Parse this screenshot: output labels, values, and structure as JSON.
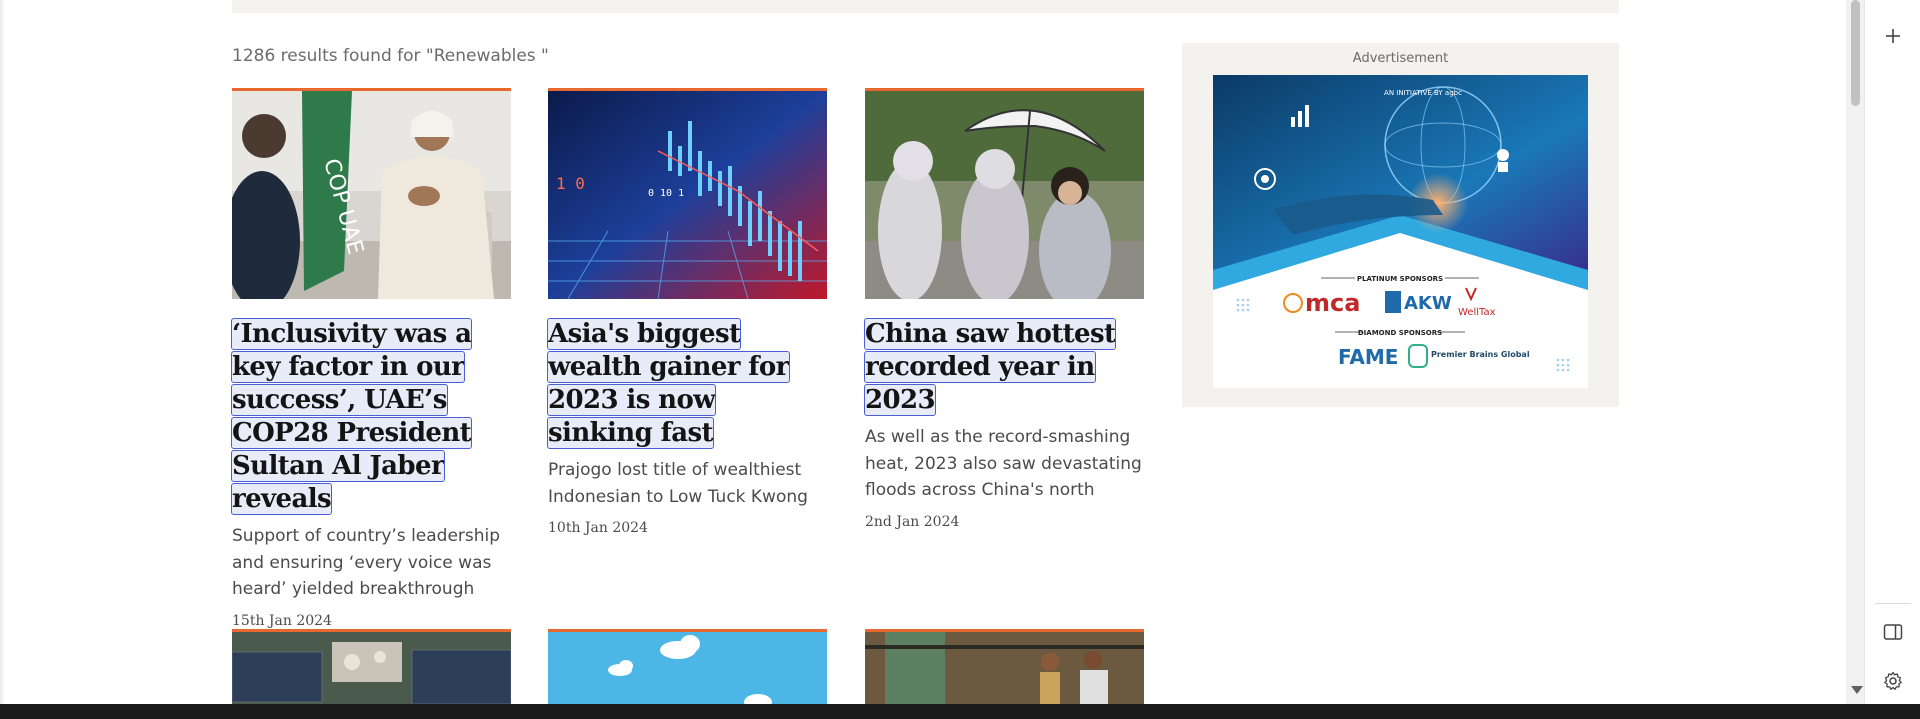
{
  "search": {
    "results_text": "1286 results found for \"Renewables \""
  },
  "articles": [
    {
      "title": "‘Inclusivity was a key factor in our success’, UAE’s COP28 President Sultan Al Jaber reveals",
      "summary": "Support of country’s leadership and ensuring ‘every voice was heard’ yielded breakthrough",
      "date": "15th Jan 2024",
      "image_icon": "interview-photo"
    },
    {
      "title": "Asia's biggest wealth gainer for 2023 is now sinking fast",
      "summary": "Prajogo lost title of wealthiest Indonesian to Low Tuck Kwong",
      "date": "10th Jan 2024",
      "image_icon": "stock-chart-photo"
    },
    {
      "title": "China saw hottest recorded year in 2023",
      "summary": "As well as the record-smashing heat, 2023 also saw devastating floods across China's north",
      "date": "2nd Jan 2024",
      "image_icon": "umbrella-street-photo"
    }
  ],
  "bottom_row_images": [
    "solar-farm-photo",
    "sky-clouds-photo",
    "workers-photo"
  ],
  "advertisement": {
    "label": "Advertisement",
    "banner_header": "AN INITIATIVE BY agbc",
    "platinum_heading": "PLATINUM SPONSORS",
    "diamond_heading": "DIAMOND SPONSORS",
    "platinum_sponsors": [
      "mca",
      "AKW",
      "WellTax"
    ],
    "diamond_sponsors": [
      "FAME",
      "Premier Brains Global"
    ]
  },
  "side_panel": {
    "icons": [
      "plus-icon",
      "sidebar-toggle-icon",
      "gear-icon"
    ]
  },
  "colors": {
    "accent_orange": "#e8692f",
    "highlight_blue": "#4a5ed8",
    "ad_blue": "#1d8fc4"
  }
}
